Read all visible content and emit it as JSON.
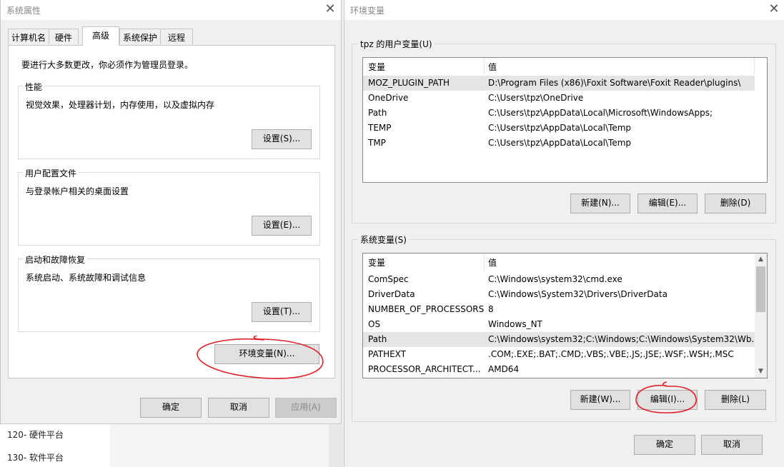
{
  "background": {
    "items": [
      "120- 硬件平台",
      "130- 软件平台"
    ]
  },
  "left_dialog": {
    "title": "系统属性",
    "close_glyph": "✕",
    "tabs": [
      "计算机名",
      "硬件",
      "高级",
      "系统保护",
      "远程"
    ],
    "active_tab": "高级",
    "admin_note": "要进行大多数更改，你必须作为管理员登录。",
    "performance": {
      "label": "性能",
      "desc": "视觉效果，处理器计划，内存使用，以及虚拟内存",
      "button": "设置(S)..."
    },
    "user_profiles": {
      "label": "用户配置文件",
      "desc": "与登录帐户相关的桌面设置",
      "button": "设置(E)..."
    },
    "startup_recovery": {
      "label": "启动和故障恢复",
      "desc": "系统启动、系统故障和调试信息",
      "button": "设置(T)..."
    },
    "env_button": "环境变量(N)...",
    "ok": "确定",
    "cancel": "取消",
    "apply": "应用(A)"
  },
  "right_dialog": {
    "title": "环境变量",
    "close_glyph": "✕",
    "user_vars": {
      "label": "tpz 的用户变量(U)",
      "headers": [
        "变量",
        "值"
      ],
      "rows": [
        {
          "name": "MOZ_PLUGIN_PATH",
          "value": "D:\\Program Files (x86)\\Foxit Software\\Foxit Reader\\plugins\\"
        },
        {
          "name": "OneDrive",
          "value": "C:\\Users\\tpz\\OneDrive"
        },
        {
          "name": "Path",
          "value": "C:\\Users\\tpz\\AppData\\Local\\Microsoft\\WindowsApps;"
        },
        {
          "name": "TEMP",
          "value": "C:\\Users\\tpz\\AppData\\Local\\Temp"
        },
        {
          "name": "TMP",
          "value": "C:\\Users\\tpz\\AppData\\Local\\Temp"
        }
      ],
      "selected_row": "MOZ_PLUGIN_PATH",
      "new": "新建(N)...",
      "edit": "编辑(E)...",
      "delete": "删除(D)"
    },
    "system_vars": {
      "label": "系统变量(S)",
      "headers": [
        "变量",
        "值"
      ],
      "rows": [
        {
          "name": "ComSpec",
          "value": "C:\\Windows\\system32\\cmd.exe"
        },
        {
          "name": "DriverData",
          "value": "C:\\Windows\\System32\\Drivers\\DriverData"
        },
        {
          "name": "NUMBER_OF_PROCESSORS",
          "value": "8"
        },
        {
          "name": "OS",
          "value": "Windows_NT"
        },
        {
          "name": "Path",
          "value": "C:\\Windows\\system32;C:\\Windows;C:\\Windows\\System32\\Wb..."
        },
        {
          "name": "PATHEXT",
          "value": ".COM;.EXE;.BAT;.CMD;.VBS;.VBE;.JS;.JSE;.WSF;.WSH;.MSC"
        },
        {
          "name": "PROCESSOR_ARCHITECT...",
          "value": "AMD64"
        }
      ],
      "selected_row": "Path",
      "new": "新建(W)...",
      "edit": "编辑(I)...",
      "delete": "删除(L)"
    },
    "ok": "确定",
    "cancel": "取消"
  },
  "colors": {
    "annotation": "#e0202a",
    "focus": "#0078d7"
  }
}
